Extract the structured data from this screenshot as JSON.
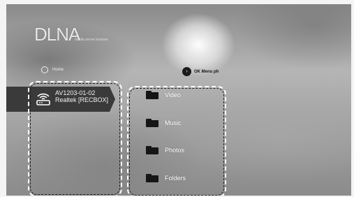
{
  "app": {
    "logo_text": "DLNA",
    "logo_subtext": "media server browser"
  },
  "home": {
    "label": "Home",
    "icon": "home-circle-icon"
  },
  "hint": {
    "button_glyph": "›",
    "text": "OK  Menu ph"
  },
  "server": {
    "icon": "wifi-router-icon",
    "name": "AV1203-01-02 Realtek [RECBOX]"
  },
  "folders": [
    {
      "label": "Video",
      "icon": "folder-icon"
    },
    {
      "label": "Music",
      "icon": "folder-icon"
    },
    {
      "label": "Photos",
      "icon": "folder-icon"
    },
    {
      "label": "Folders",
      "icon": "folder-icon"
    }
  ],
  "colors": {
    "selected_tab": "#3a3a3a",
    "folder_icon": "#151515",
    "focus_outline": "#ffffff"
  }
}
